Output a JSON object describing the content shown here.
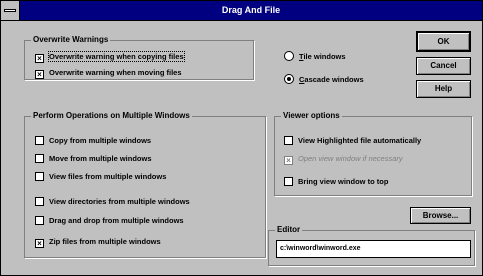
{
  "window": {
    "title": "Drag And File"
  },
  "overwrite": {
    "legend": "Overwrite Warnings",
    "items": [
      {
        "label": "Overwrite warning when copying files",
        "checked": true
      },
      {
        "label": "Overwrite warning when moving files",
        "checked": true
      }
    ]
  },
  "arrange": {
    "tile_label": "Tile windows",
    "cascade_label": "Cascade windows",
    "selected": "cascade"
  },
  "buttons": {
    "ok": "OK",
    "cancel": "Cancel",
    "help": "Help",
    "browse": "Browse..."
  },
  "multi": {
    "legend": "Perform Operations on Multiple Windows",
    "items": [
      {
        "label": "Copy from multiple windows",
        "checked": false
      },
      {
        "label": "Move from multiple windows",
        "checked": false
      },
      {
        "label": "View files from multiple windows",
        "checked": false
      },
      {
        "label": "View directories from multiple windows",
        "checked": false
      },
      {
        "label": "Drag and drop from multiple windows",
        "checked": false
      },
      {
        "label": "Zip files from multiple windows",
        "checked": true
      }
    ]
  },
  "viewer": {
    "legend": "Viewer options",
    "items": [
      {
        "label": "View Highlighted file automatically",
        "checked": false,
        "disabled": false
      },
      {
        "label": "Open view window if necessary",
        "checked": true,
        "disabled": true
      },
      {
        "label": "Bring view window to top",
        "checked": false,
        "disabled": false
      }
    ]
  },
  "editor": {
    "legend": "Editor",
    "value": "c:\\winword\\winword.exe"
  }
}
